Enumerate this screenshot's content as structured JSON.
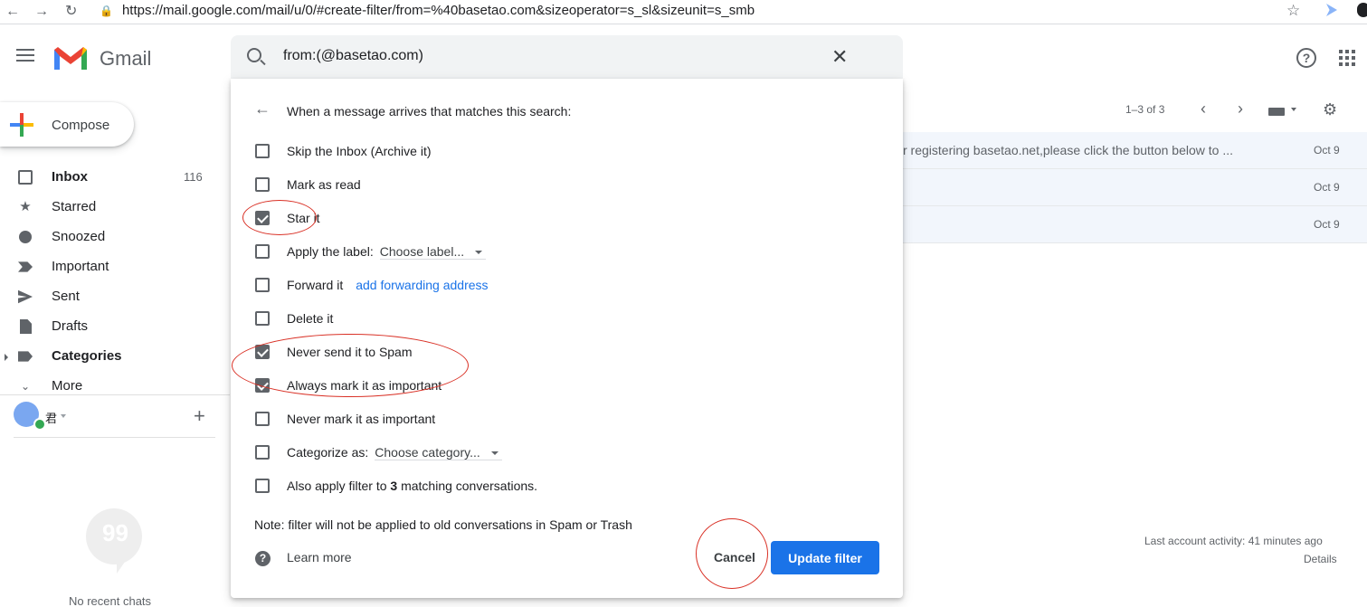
{
  "browser": {
    "url": "https://mail.google.com/mail/u/0/#create-filter/from=%40basetao.com&sizeoperator=s_sl&sizeunit=s_smb"
  },
  "app": {
    "name": "Gmail"
  },
  "search": {
    "query": "from:(@basetao.com)"
  },
  "compose": {
    "label": "Compose"
  },
  "sidebar": {
    "items": [
      {
        "label": "Inbox",
        "count": "116",
        "icon": "inbox-icon"
      },
      {
        "label": "Starred",
        "icon": "star-icon"
      },
      {
        "label": "Snoozed",
        "icon": "clock-icon"
      },
      {
        "label": "Important",
        "icon": "important-icon"
      },
      {
        "label": "Sent",
        "icon": "send-icon"
      },
      {
        "label": "Drafts",
        "icon": "draft-icon"
      },
      {
        "label": "Categories",
        "icon": "label-icon"
      },
      {
        "label": "More",
        "icon": "chevron-down-icon"
      }
    ]
  },
  "hangouts": {
    "user": "君",
    "empty_text": "No recent chats"
  },
  "filter": {
    "heading": "When a message arrives that matches this search:",
    "options": [
      {
        "label": "Skip the Inbox (Archive it)",
        "checked": false
      },
      {
        "label": "Mark as read",
        "checked": false
      },
      {
        "label": "Star it",
        "checked": true
      },
      {
        "label": "Apply the label:",
        "checked": false,
        "dropdown": "Choose label..."
      },
      {
        "label": "Forward it",
        "checked": false,
        "link": "add forwarding address"
      },
      {
        "label": "Delete it",
        "checked": false
      },
      {
        "label": "Never send it to Spam",
        "checked": true
      },
      {
        "label": "Always mark it as important",
        "checked": true
      },
      {
        "label": "Never mark it as important",
        "checked": false
      },
      {
        "label": "Categorize as:",
        "checked": false,
        "dropdown": "Choose category..."
      }
    ],
    "also_apply_prefix": "Also apply filter to",
    "also_apply_count": "3",
    "also_apply_suffix": "matching conversations.",
    "note": "Note: filter will not be applied to old conversations in Spam or Trash",
    "learn_more": "Learn more",
    "cancel": "Cancel",
    "update": "Update filter"
  },
  "mail_list": {
    "pager": "1–3 of 3",
    "rows": [
      {
        "snippet": "r registering basetao.net,please click the button below to ...",
        "date": "Oct 9"
      },
      {
        "snippet": "",
        "date": "Oct 9"
      },
      {
        "snippet": "",
        "date": "Oct 9"
      }
    ],
    "activity": "Last account activity: 41 minutes ago",
    "details": "Details"
  },
  "colors": {
    "accent": "#1a73e8",
    "annotation": "#d93025",
    "checkbox": "#5f6368"
  }
}
